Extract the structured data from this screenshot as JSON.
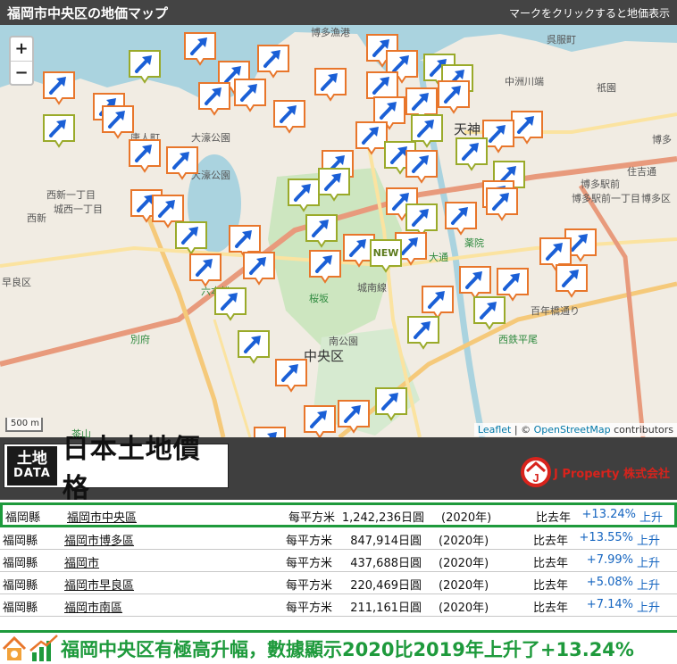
{
  "header": {
    "title": "福岡市中央区の地価マップ",
    "hint": "マークをクリックすると地価表示"
  },
  "map": {
    "zoom_in": "+",
    "zoom_out": "−",
    "scale": "500 m",
    "attribution": {
      "leaflet": "Leaflet",
      "sep": " | © ",
      "osm": "OpenStreetMap",
      "contrib": " contributors"
    },
    "new_label": "NEW",
    "labels": {
      "hakata_gyoko": "博多漁港",
      "gofukumachi": "呉服町",
      "nakasukawabata": "中洲川端",
      "gion": "祇園",
      "hakata": "博多",
      "tojinmachi": "唐人町",
      "ohori_koen": "大濠公園",
      "ohori_koen2": "大濠公園",
      "nishi_ichome": "西新一丁目",
      "jonai": "城西一丁目",
      "nishijin": "西新",
      "tenjin": "天神",
      "sakurazaka": "桜坂",
      "ropponmatsu": "六本松",
      "yakuin": "薬院",
      "otemon": "大通",
      "nishitetsu_hirao": "西鉄平尾",
      "minami_koen": "南公園",
      "chuo_ku": "中央区",
      "beppu": "別府",
      "chayama": "茶山",
      "hakata_ekimae": "博多駅前",
      "sumiyoshi": "住吉通",
      "hirao": "百年橋通り",
      "jyonan": "城南線",
      "sawara": "早良区",
      "hakata2": "博多区",
      "kushida": "博多駅前一丁目"
    }
  },
  "brand": {
    "logo_kanji": "土地",
    "logo_data": "DATA",
    "logo_name": "日本土地價格",
    "company": "J Property 株式会社"
  },
  "table": {
    "rows": [
      {
        "pref": "福岡縣",
        "city": "福岡市中央區",
        "unit": "每平方米",
        "price": "1,242,236日圓",
        "year": "(2020年)",
        "cmp": "比去年",
        "pct": "+13.24%",
        "trend": "上升"
      },
      {
        "pref": "福岡縣",
        "city": "福岡市博多區",
        "unit": "每平方米",
        "price": "847,914日圓",
        "year": "(2020年)",
        "cmp": "比去年",
        "pct": "+13.55%",
        "trend": "上升"
      },
      {
        "pref": "福岡縣",
        "city": "福岡市",
        "unit": "每平方米",
        "price": "437,688日圓",
        "year": "(2020年)",
        "cmp": "比去年",
        "pct": "+7.99%",
        "trend": "上升"
      },
      {
        "pref": "福岡縣",
        "city": "福岡市早良區",
        "unit": "每平方米",
        "price": "220,469日圓",
        "year": "(2020年)",
        "cmp": "比去年",
        "pct": "+5.08%",
        "trend": "上升"
      },
      {
        "pref": "福岡縣",
        "city": "福岡市南區",
        "unit": "每平方米",
        "price": "211,161日圓",
        "year": "(2020年)",
        "cmp": "比去年",
        "pct": "+7.14%",
        "trend": "上升"
      }
    ]
  },
  "banner": {
    "message": "福岡中央区有極高升幅，數據顯示2020比2019年上升了+13.24%"
  },
  "colors": {
    "marker_orange": "#e8762b",
    "marker_green": "#9aaa2a",
    "arrow_blue": "#1a5fd6",
    "accent_green": "#1e9a3c",
    "header_bg": "#444444",
    "brand_red": "#d8231c"
  }
}
